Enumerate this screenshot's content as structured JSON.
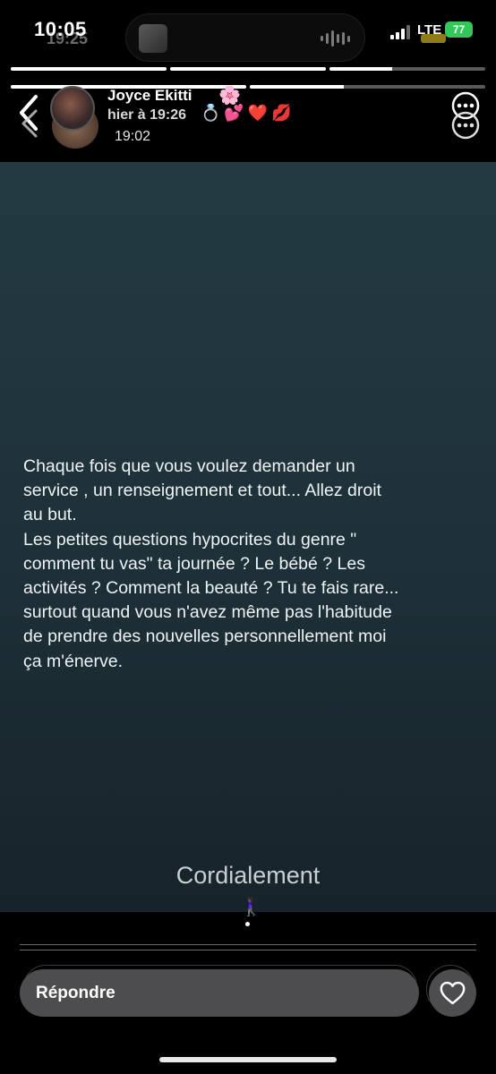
{
  "status_bar": {
    "time": "10:05",
    "time_ghost": "19:25",
    "network": "LTE",
    "battery": "77"
  },
  "story_progress": [
    {
      "fill": 1.0
    },
    {
      "fill": 1.0
    },
    {
      "fill": 0.4
    }
  ],
  "story_progress_ghost": [
    {
      "fill": 1.0
    },
    {
      "fill": 0.4
    }
  ],
  "header": {
    "username": "Joyce Ekitti",
    "flower_emoji": "🌸",
    "sub_ghost": "hier à 19:26",
    "emojis": "💍💕❤️💋",
    "posted_time": "19:02"
  },
  "story": {
    "text": "Chaque fois que vous voulez demander un\nservice , un renseignement et tout... Allez droit\nau but.\nLes petites questions hypocrites du genre \"\ncomment tu vas\" ta journée ? Le bébé ? Les\nactivités ? Comment la beauté ? Tu te fais rare...\nsurtout quand vous n'avez même pas l'habitude\nde prendre des nouvelles personnellement moi\nça m'énerve.",
    "signoff": "Cordialement",
    "walker_emoji": "🚶🏿‍♀️"
  },
  "footer": {
    "reply_label": "Répondre"
  },
  "colors": {
    "story_bg_top": "#233a42",
    "story_bg_bottom": "#17232a",
    "battery": "#34c759",
    "reply_field": "#4d4d4f"
  },
  "icons": [
    "back-chevron-icon",
    "more-options-icon",
    "heart-icon",
    "signal-icon",
    "battery-icon",
    "audio-wave-icon"
  ]
}
